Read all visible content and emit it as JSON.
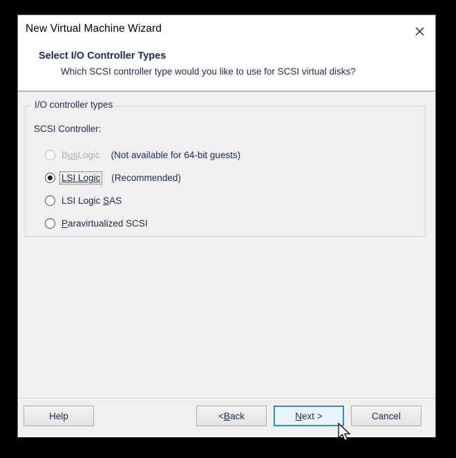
{
  "window": {
    "title": "New Virtual Machine Wizard",
    "close_icon": "close-icon"
  },
  "header": {
    "title": "Select I/O Controller Types",
    "subtitle": "Which SCSI controller type would you like to use for SCSI virtual disks?"
  },
  "group": {
    "legend": "I/O controller types",
    "field_label": "SCSI Controller:",
    "options": [
      {
        "label": "BusLogic",
        "mnemonic_before": "B",
        "mnemonic": "us",
        "mnemonic_after": "Logic",
        "note": "(Not available for 64-bit guests)",
        "selected": false,
        "disabled": true,
        "focused": false
      },
      {
        "label": "LSI Logic",
        "mnemonic_before": "",
        "mnemonic": "LSI Logic",
        "mnemonic_after": "",
        "note": "(Recommended)",
        "selected": true,
        "disabled": false,
        "focused": true
      },
      {
        "label": "LSI Logic SAS",
        "mnemonic_before": "LSI Logic ",
        "mnemonic": "S",
        "mnemonic_after": "AS",
        "note": "",
        "selected": false,
        "disabled": false,
        "focused": false
      },
      {
        "label": "Paravirtualized SCSI",
        "mnemonic_before": "",
        "mnemonic": "P",
        "mnemonic_after": "aravirtualized SCSI",
        "note": "",
        "selected": false,
        "disabled": false,
        "focused": false
      }
    ]
  },
  "footer": {
    "help": "Help",
    "back_before": "< ",
    "back_mnemonic": "B",
    "back_after": "ack",
    "next_mnemonic": "N",
    "next_after": "ext >",
    "cancel": "Cancel"
  },
  "colors": {
    "accent": "#2d8ccd",
    "window_bg": "#f0f0f0",
    "text": "#1b2a57",
    "disabled_text": "#b0b0b0"
  }
}
